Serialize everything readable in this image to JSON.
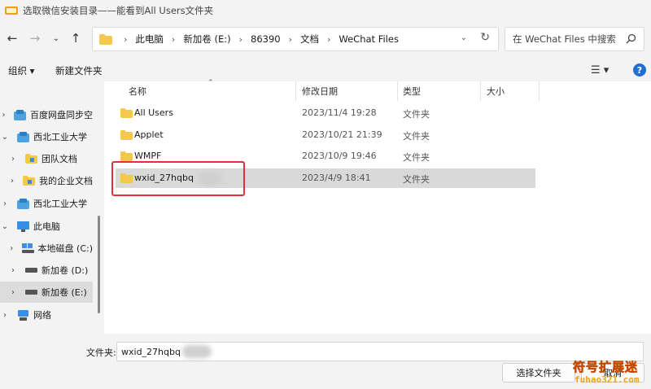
{
  "window": {
    "title": "选取微信安装目录——能看到All Users文件夹"
  },
  "address": {
    "crumbs": [
      "此电脑",
      "新加卷 (E:)",
      "86390",
      "文档",
      "WeChat Files"
    ]
  },
  "search": {
    "placeholder": "在 WeChat Files 中搜索"
  },
  "toolbar": {
    "organize": "组织 ▾",
    "new_folder": "新建文件夹"
  },
  "sidebar": {
    "items": [
      {
        "label": "百度网盘同步空",
        "expanded": false,
        "icon": "cloud-folder-icon"
      },
      {
        "label": "西北工业大学",
        "expanded": true,
        "icon": "cloud-folder-icon"
      },
      {
        "label": "团队文档",
        "expanded": false,
        "icon": "folder-icon"
      },
      {
        "label": "我的企业文档",
        "expanded": false,
        "icon": "folder-icon"
      },
      {
        "label": "西北工业大学",
        "expanded": false,
        "icon": "cloud-folder-icon"
      },
      {
        "label": "此电脑",
        "expanded": true,
        "icon": "pc-icon"
      },
      {
        "label": "本地磁盘 (C:)",
        "expanded": false,
        "icon": "drive-icon"
      },
      {
        "label": "新加卷 (D:)",
        "expanded": false,
        "icon": "drive-icon"
      },
      {
        "label": "新加卷 (E:)",
        "expanded": false,
        "icon": "drive-icon",
        "selected": true
      },
      {
        "label": "网络",
        "expanded": false,
        "icon": "network-icon"
      }
    ]
  },
  "columns": {
    "name": "名称",
    "date": "修改日期",
    "type": "类型",
    "size": "大小"
  },
  "files": [
    {
      "name": "All Users",
      "date": "2023/11/4 19:28",
      "type": "文件夹"
    },
    {
      "name": "Applet",
      "date": "2023/10/21 21:39",
      "type": "文件夹"
    },
    {
      "name": "WMPF",
      "date": "2023/10/9 19:46",
      "type": "文件夹"
    },
    {
      "name": "wxid_27hqbq",
      "date": "2023/4/9 18:41",
      "type": "文件夹",
      "selected": true
    }
  ],
  "footer": {
    "filename_label": "文件夹:",
    "filename_value": "wxid_27hqbq",
    "select_button": "选择文件夹",
    "cancel_button": "取消"
  },
  "watermark": {
    "line1": "符号扩展迷",
    "line2": "fuhao321.com"
  },
  "colors": {
    "accent": "#1f6fd1",
    "folder": "#f2c94c",
    "highlight_box": "#e1303b"
  }
}
